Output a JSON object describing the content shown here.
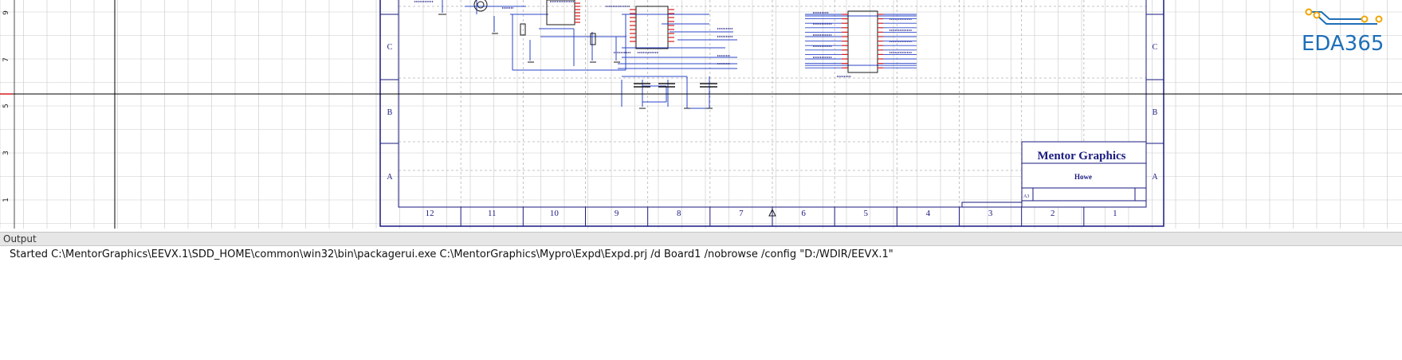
{
  "schematic": {
    "border_rows": [
      "C",
      "B",
      "A"
    ],
    "border_columns": [
      "12",
      "11",
      "10",
      "9",
      "8",
      "7",
      "6",
      "5",
      "4",
      "3",
      "2",
      "1"
    ],
    "ruler_labels": [
      "9",
      "7",
      "5",
      "3",
      "1"
    ],
    "title_block": {
      "company_logo_text": "Mentor Graphics",
      "sheet_title": "Howe",
      "size_code": "A3"
    },
    "colors": {
      "grid": "#c9c9c9",
      "dashed_grid": "#b4b4b4",
      "border": "#1a1a80",
      "wire": "#2b44c8",
      "pin_marker": "#d41c1c",
      "crosshair": "#000000"
    }
  },
  "watermark": {
    "text": "EDA365",
    "color": "#1e6fb8",
    "accent": "#f0a500"
  },
  "output": {
    "title": "Output",
    "lines": [
      "Started C:\\MentorGraphics\\EEVX.1\\SDD_HOME\\common\\win32\\bin\\packagerui.exe C:\\MentorGraphics\\Mypro\\Expd\\Expd.prj /d Board1 /nobrowse /config \"D:/WDIR/EEVX.1\""
    ]
  }
}
